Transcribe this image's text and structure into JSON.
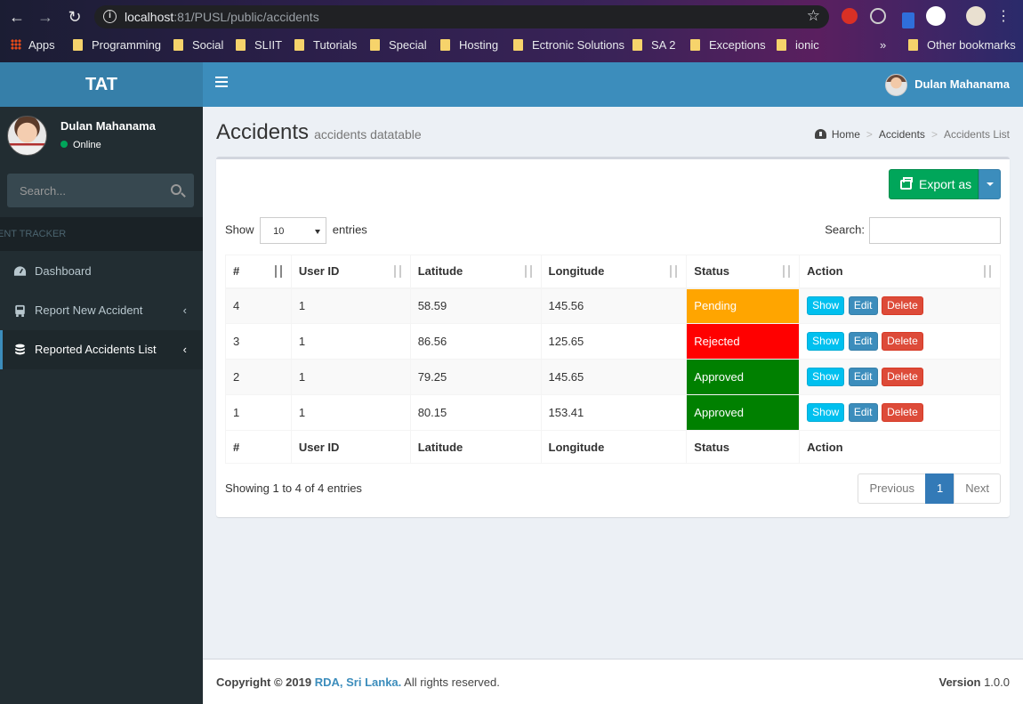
{
  "browser": {
    "url_host": "localhost",
    "url_rest": ":81/PUSL/public/accidents",
    "bookmarks": [
      "Apps",
      "Programming",
      "Social",
      "SLIIT",
      "Tutorials",
      "Special",
      "Hosting",
      "Ectronic Solutions",
      "SA 2",
      "Exceptions",
      "ionic"
    ],
    "more": "»",
    "other_bookmarks": "Other bookmarks"
  },
  "app": {
    "logo": "TAT",
    "top_user": "Dulan Mahanama"
  },
  "sidebar": {
    "user_name": "Dulan Mahanama",
    "user_status": "Online",
    "search_placeholder": "Search...",
    "header": "IDENT TRACKER",
    "items": [
      {
        "label": "Dashboard",
        "icon": "dashboard-icon"
      },
      {
        "label": "Report New Accident",
        "icon": "bus-icon"
      },
      {
        "label": "Reported Accidents List",
        "icon": "database-icon"
      }
    ]
  },
  "page": {
    "title": "Accidents",
    "subtitle": "accidents datatable",
    "breadcrumb": [
      "Home",
      "Accidents",
      "Accidents List"
    ],
    "export_label": "Export as",
    "show_label": "Show",
    "entries_label": "entries",
    "length_value": "10",
    "search_label": "Search:",
    "columns": [
      "#",
      "User ID",
      "Latitude",
      "Longitude",
      "Status",
      "Action"
    ],
    "rows": [
      {
        "id": "4",
        "user_id": "1",
        "lat": "58.59",
        "lng": "145.56",
        "status": "Pending",
        "status_color": "#ffa500"
      },
      {
        "id": "3",
        "user_id": "1",
        "lat": "86.56",
        "lng": "125.65",
        "status": "Rejected",
        "status_color": "#ff0000"
      },
      {
        "id": "2",
        "user_id": "1",
        "lat": "79.25",
        "lng": "145.65",
        "status": "Approved",
        "status_color": "#008000"
      },
      {
        "id": "1",
        "user_id": "1",
        "lat": "80.15",
        "lng": "153.41",
        "status": "Approved",
        "status_color": "#008000"
      }
    ],
    "actions": {
      "show": "Show",
      "edit": "Edit",
      "delete": "Delete"
    },
    "info": "Showing 1 to 4 of 4 entries",
    "pager": {
      "previous": "Previous",
      "current": "1",
      "next": "Next"
    }
  },
  "footer": {
    "copy_prefix": "Copyright © 2019",
    "org": "RDA, Sri Lanka.",
    "rights": "All rights reserved.",
    "version_label": "Version",
    "version": "1.0.0"
  }
}
